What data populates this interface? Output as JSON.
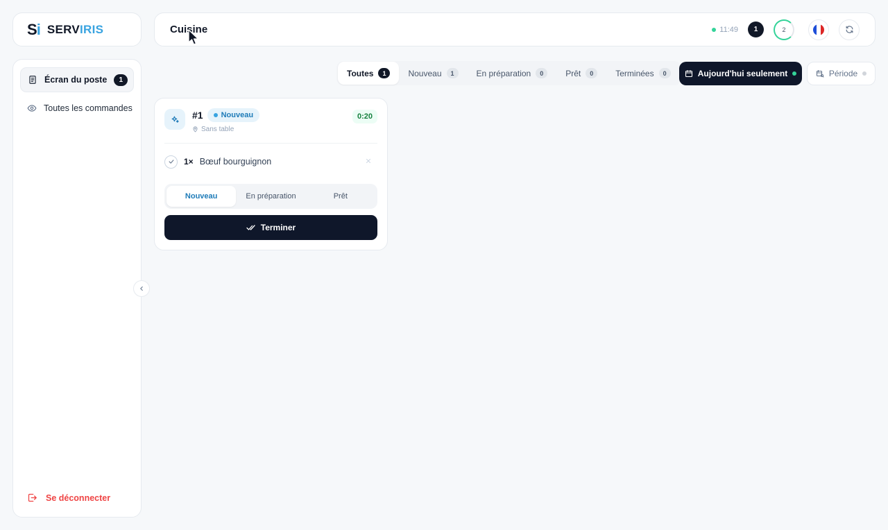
{
  "brand": {
    "mark_s": "S",
    "mark_i": "i",
    "name_part1": "SERV",
    "name_part2": "IRIS"
  },
  "colors": {
    "accent": "#38a3e0",
    "dark": "#0f172a",
    "green": "#34d399",
    "danger": "#ef4444"
  },
  "header": {
    "title": "Cuisine",
    "time": "11:49",
    "count": "1",
    "ring_count": "2",
    "language_icon": "flag-fr-icon",
    "refresh_icon": "refresh-icon"
  },
  "sidebar": {
    "items": [
      {
        "label": "Écran du poste",
        "badge": "1",
        "icon": "clipboard-icon",
        "active": true
      },
      {
        "label": "Toutes les commandes",
        "icon": "eye-icon",
        "active": false
      }
    ],
    "logout_label": "Se déconnecter"
  },
  "filters": {
    "tabs": [
      {
        "label": "Toutes",
        "count": "1"
      },
      {
        "label": "Nouveau",
        "count": "1"
      },
      {
        "label": "En préparation",
        "count": "0"
      },
      {
        "label": "Prêt",
        "count": "0"
      },
      {
        "label": "Terminées",
        "count": "0"
      }
    ],
    "today_label": "Aujourd'hui seulement",
    "period_label": "Période"
  },
  "order": {
    "number": "#1",
    "status": "Nouveau",
    "table": "Sans table",
    "timer": "0:20",
    "items": [
      {
        "qty": "1×",
        "name": "Bœuf bourguignon"
      }
    ],
    "stages": [
      "Nouveau",
      "En préparation",
      "Prêt"
    ],
    "finish_label": "Terminer"
  }
}
